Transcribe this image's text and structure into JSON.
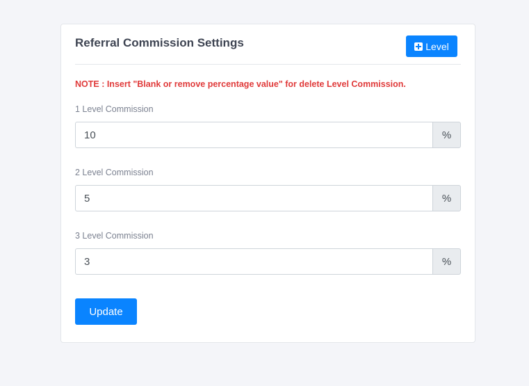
{
  "card": {
    "title": "Referral Commission Settings",
    "add_level_label": "Level",
    "note": "NOTE : Insert \"Blank or remove percentage value\" for delete Level Commission.",
    "levels": [
      {
        "label": "1 Level Commission",
        "value": "10",
        "suffix": "%"
      },
      {
        "label": "2 Level Commission",
        "value": "5",
        "suffix": "%"
      },
      {
        "label": "3 Level Commission",
        "value": "3",
        "suffix": "%"
      }
    ],
    "update_label": "Update"
  },
  "colors": {
    "page_background": "#f4f5f9",
    "primary": "#0a84ff",
    "note_red": "#e03a3a",
    "title_text": "#3e4452",
    "label_text": "#7b8190",
    "addon_background": "#e9ecef"
  }
}
